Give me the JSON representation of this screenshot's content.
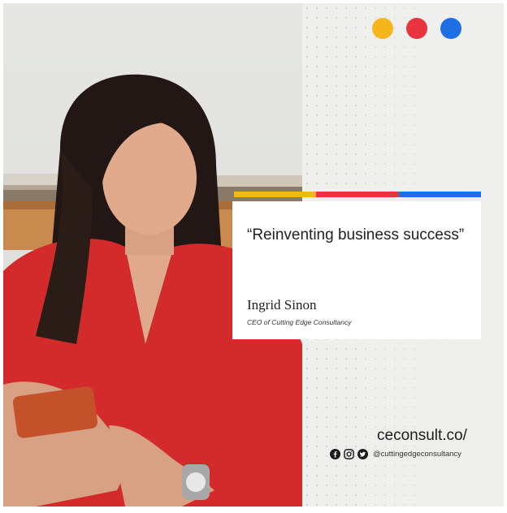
{
  "dots": {
    "colors": [
      "#f7b51c",
      "#e8343f",
      "#1e6fe6"
    ]
  },
  "bar": {
    "colors": [
      "#f7b51c",
      "#e8343f",
      "#1e6fe6"
    ]
  },
  "quote": {
    "text": "“Reinventing business success”",
    "author": "Ingrid Sinon",
    "role": "CEO of Cutting Edge Consultancy"
  },
  "footer": {
    "site": "ceconsult.co/",
    "handle": "@cuttingedgeconsultancy",
    "icons": [
      "facebook-icon",
      "instagram-icon",
      "twitter-icon"
    ]
  }
}
